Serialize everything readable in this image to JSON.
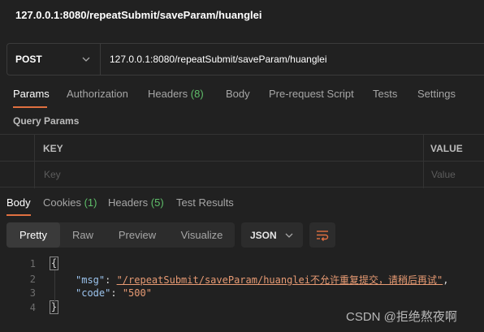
{
  "titlebar": {
    "title": "127.0.0.1:8080/repeatSubmit/saveParam/huanglei"
  },
  "request": {
    "method": "POST",
    "url": "127.0.0.1:8080/repeatSubmit/saveParam/huanglei"
  },
  "request_tabs": [
    {
      "label": "Params",
      "active": true
    },
    {
      "label": "Authorization"
    },
    {
      "label": "Headers",
      "badge": "(8)"
    },
    {
      "label": "Body"
    },
    {
      "label": "Pre-request Script"
    },
    {
      "label": "Tests"
    },
    {
      "label": "Settings"
    }
  ],
  "params": {
    "section_title": "Query Params",
    "headers": {
      "key": "KEY",
      "value": "VALUE"
    },
    "placeholders": {
      "key": "Key",
      "value": "Value"
    }
  },
  "response_tabs": [
    {
      "label": "Body",
      "active": true
    },
    {
      "label": "Cookies",
      "badge": "(1)"
    },
    {
      "label": "Headers",
      "badge": "(5)"
    },
    {
      "label": "Test Results"
    }
  ],
  "view": {
    "options": [
      "Pretty",
      "Raw",
      "Preview",
      "Visualize"
    ],
    "selected": "Pretty",
    "format": "JSON",
    "wrap_icon": "wrap-lines-icon"
  },
  "response_body": {
    "line_numbers": [
      "1",
      "2",
      "3",
      "4"
    ],
    "open_brace": "{",
    "close_brace": "}",
    "msg_key": "\"msg\"",
    "msg_value": "\"/repeatSubmit/saveParam/huanglei不允许重复提交，请稍后再试\"",
    "code_key": "\"code\"",
    "code_value": "\"500\""
  },
  "watermark": "CSDN @拒绝熬夜啊",
  "colors": {
    "accent": "#e07040",
    "badge": "#5fbf6a",
    "json_key": "#9cc4ee",
    "json_string": "#e79a73"
  }
}
